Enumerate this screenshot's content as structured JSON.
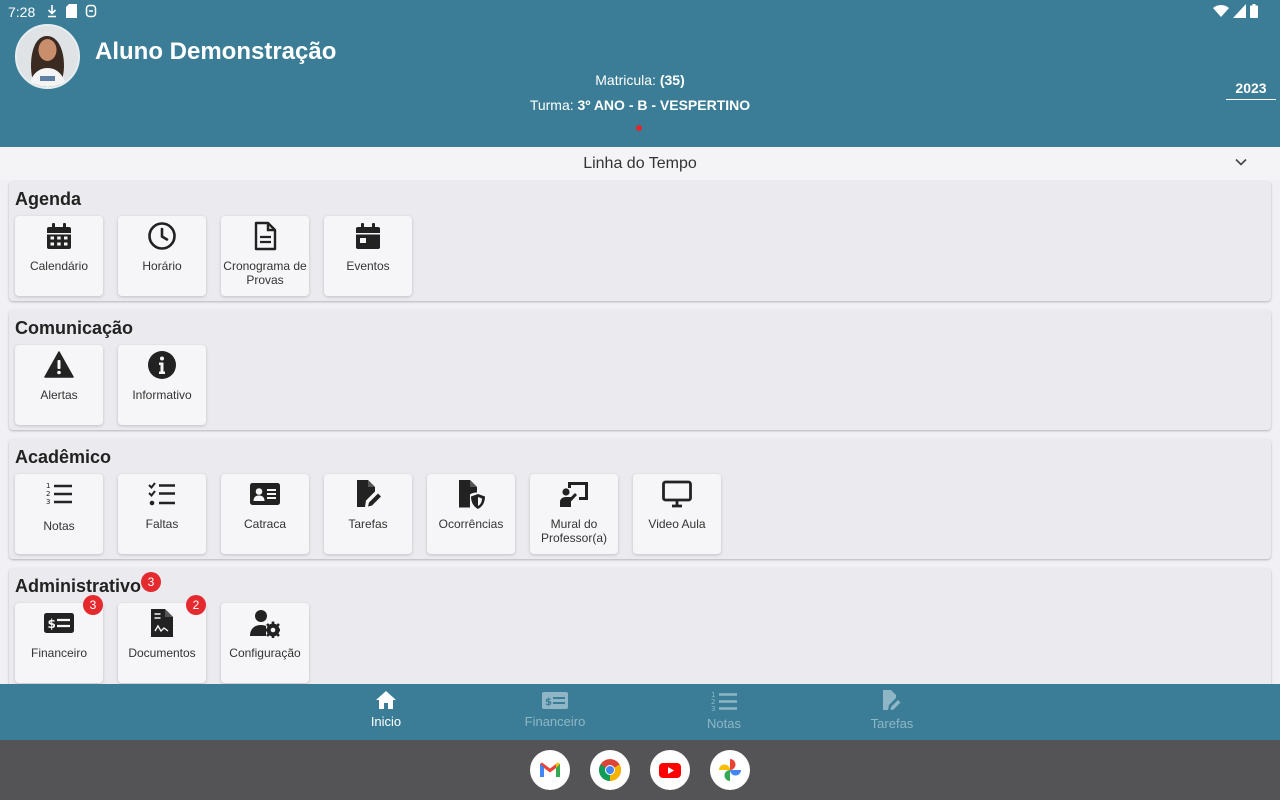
{
  "status_bar": {
    "time": "7:28"
  },
  "header": {
    "student_name": "Aluno Demonstração",
    "matricula_label": "Matricula:",
    "matricula_value": "(35)",
    "turma_label": "Turma:",
    "turma_value": "3º ANO - B - VESPERTINO",
    "year": "2023"
  },
  "timeline": {
    "label": "Linha do Tempo"
  },
  "sections": {
    "agenda": {
      "title": "Agenda",
      "tiles": [
        {
          "label": "Calendário",
          "icon": "calendar-icon"
        },
        {
          "label": "Horário",
          "icon": "clock-icon"
        },
        {
          "label": "Cronograma de Provas",
          "icon": "document-icon"
        },
        {
          "label": "Eventos",
          "icon": "event-icon"
        }
      ]
    },
    "comunicacao": {
      "title": "Comunicação",
      "tiles": [
        {
          "label": "Alertas",
          "icon": "warning-icon"
        },
        {
          "label": "Informativo",
          "icon": "info-icon"
        }
      ]
    },
    "academico": {
      "title": "Acadêmico",
      "tiles": [
        {
          "label": "Notas",
          "icon": "numbered-list-icon"
        },
        {
          "label": "Faltas",
          "icon": "checklist-icon"
        },
        {
          "label": "Catraca",
          "icon": "id-card-icon"
        },
        {
          "label": "Tarefas",
          "icon": "file-edit-icon"
        },
        {
          "label": "Ocorrências",
          "icon": "file-shield-icon"
        },
        {
          "label": "Mural do Professor(a)",
          "icon": "teacher-board-icon"
        },
        {
          "label": "Video Aula",
          "icon": "monitor-icon"
        }
      ]
    },
    "administrativo": {
      "title": "Administrativo",
      "badge": "3",
      "tiles": [
        {
          "label": "Financeiro",
          "icon": "money-bill-icon",
          "badge": "3"
        },
        {
          "label": "Documentos",
          "icon": "invoice-icon",
          "badge": "2"
        },
        {
          "label": "Configuração",
          "icon": "user-gear-icon"
        }
      ]
    }
  },
  "bottom_nav": {
    "items": [
      {
        "label": "Inicio",
        "icon": "home-icon",
        "active": true
      },
      {
        "label": "Financeiro",
        "icon": "money-bill-icon",
        "active": false
      },
      {
        "label": "Notas",
        "icon": "numbered-list-icon",
        "active": false
      },
      {
        "label": "Tarefas",
        "icon": "file-edit-icon",
        "active": false
      }
    ]
  },
  "dock": {
    "apps": [
      {
        "name": "gmail-icon"
      },
      {
        "name": "chrome-icon"
      },
      {
        "name": "youtube-icon"
      },
      {
        "name": "photos-icon"
      }
    ]
  },
  "colors": {
    "header_bg": "#3b7d96",
    "badge_red": "#e42a2f",
    "tile_bg": "#f6f6f8",
    "section_bg": "#ebeaee"
  }
}
